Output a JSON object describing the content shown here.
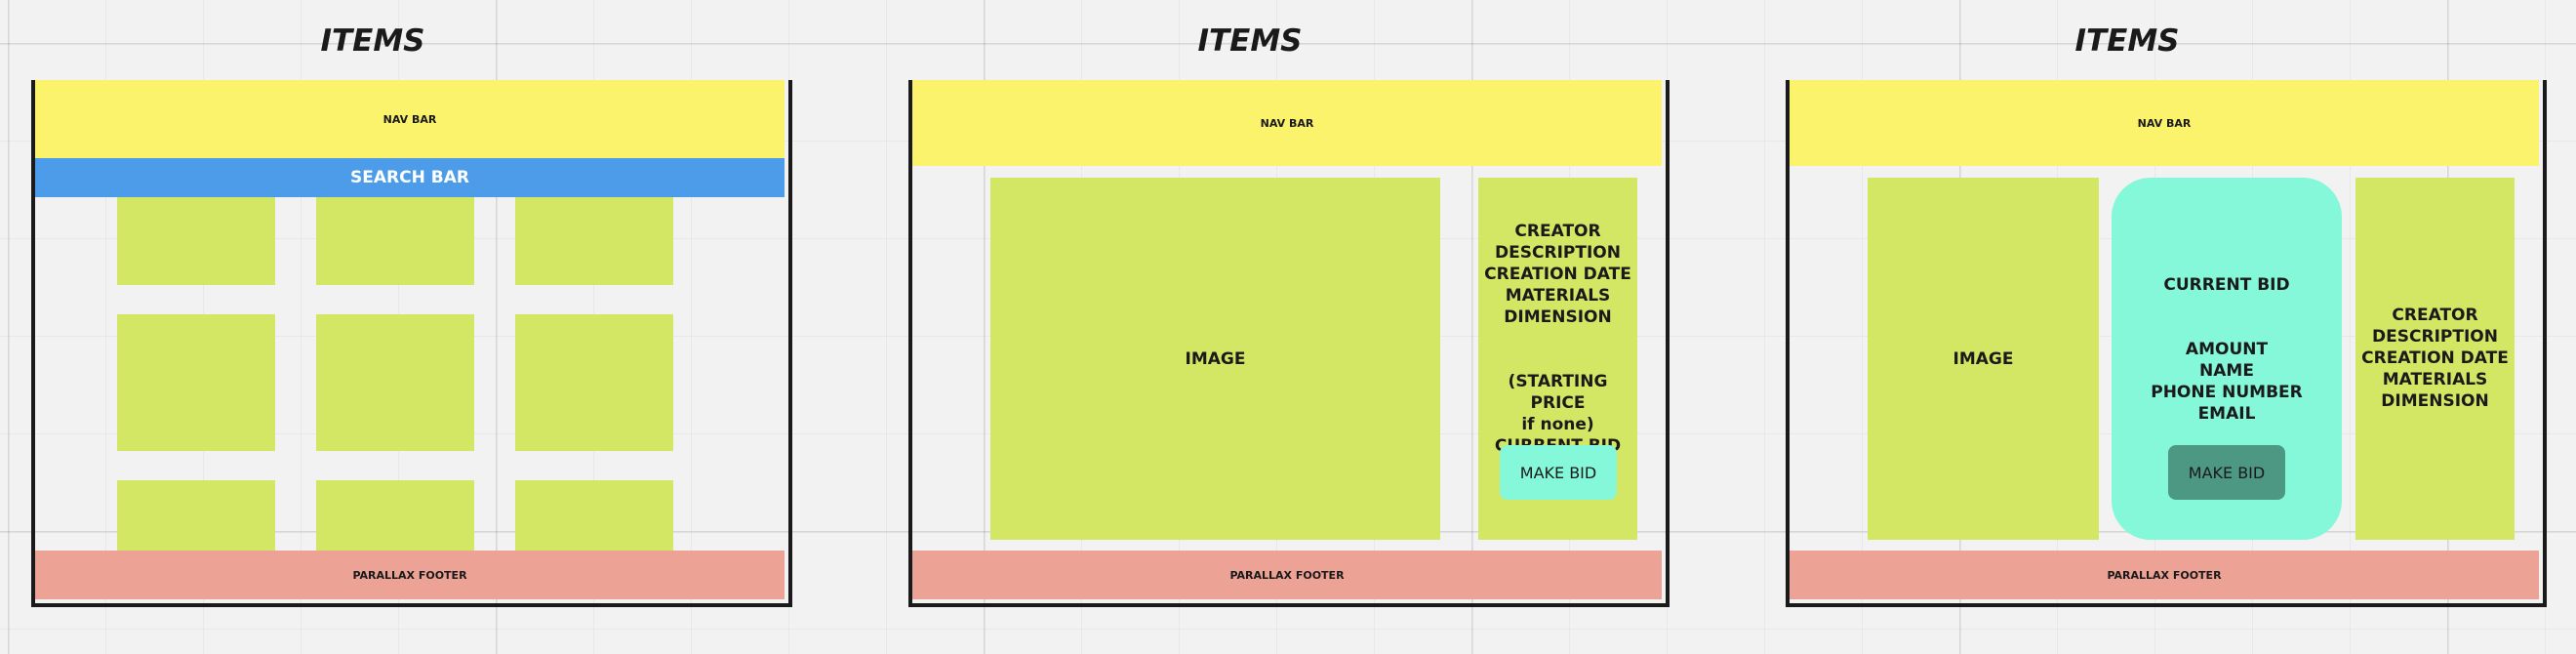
{
  "frames": [
    {
      "title": "ITEMS",
      "nav": "NAV BAR",
      "search": "SEARCH BAR",
      "footer": "PARALLAX FOOTER"
    },
    {
      "title": "ITEMS",
      "nav": "NAV BAR",
      "image": "IMAGE",
      "info_lines": [
        "CREATOR",
        "DESCRIPTION",
        "CREATION DATE",
        "MATERIALS",
        "DIMENSION"
      ],
      "price_lines": [
        "(STARTING PRICE",
        "if none)",
        "CURRENT BID"
      ],
      "button": "MAKE BID",
      "footer": "PARALLAX FOOTER"
    },
    {
      "title": "ITEMS",
      "nav": "NAV BAR",
      "image": "IMAGE",
      "bid_title": "CURRENT BID",
      "bid_lines": [
        "AMOUNT",
        "NAME",
        "PHONE NUMBER",
        "EMAIL"
      ],
      "button": "MAKE BID",
      "info_lines": [
        "CREATOR",
        "DESCRIPTION",
        "CREATION DATE",
        "MATERIALS",
        "DIMENSION"
      ],
      "footer": "PARALLAX FOOTER"
    }
  ],
  "colors": {
    "nav": "#fbf36c",
    "search": "#4d9cea",
    "tile": "#d3e765",
    "footer": "#eca295",
    "bid_panel": "#84f8d9",
    "button_light": "#84f8d9",
    "button_dark": "#4c9882"
  }
}
